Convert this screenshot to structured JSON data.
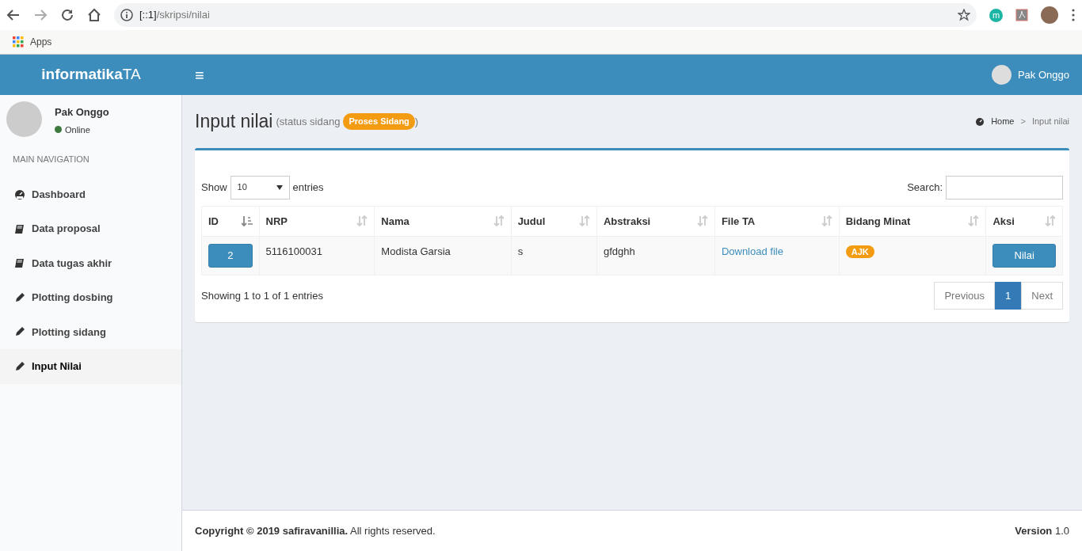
{
  "browser": {
    "url_host": "[::1]",
    "url_path": "/skripsi/nilai",
    "bookmarks": [
      {
        "label": "Apps"
      }
    ],
    "extension_label": "m"
  },
  "header": {
    "logo_bold": "informatika",
    "logo_light": "TA",
    "menu_glyph": "≡",
    "user_name": "Pak Onggo"
  },
  "sidebar": {
    "user_name": "Pak Onggo",
    "status": "Online",
    "section": "MAIN NAVIGATION",
    "items": [
      {
        "label": "Dashboard",
        "kind": "dashboard",
        "selected": false
      },
      {
        "label": "Data proposal",
        "kind": "book",
        "selected": false
      },
      {
        "label": "Data tugas akhir",
        "kind": "book",
        "selected": false
      },
      {
        "label": "Plotting dosbing",
        "kind": "pencil",
        "selected": false
      },
      {
        "label": "Plotting sidang",
        "kind": "pencil",
        "selected": false
      },
      {
        "label": "Input Nilai",
        "kind": "pencil",
        "selected": true
      }
    ]
  },
  "page": {
    "title": "Input nilai",
    "subtitle_before": "(status sidang",
    "status_badge": "Proses Sidang",
    "subtitle_after": ")",
    "breadcrumb_separator": ">",
    "breadcrumb": [
      {
        "label": "Home"
      },
      {
        "label": "Input nilai"
      }
    ]
  },
  "table": {
    "show_label": "Show",
    "page_size": "10",
    "entries_label": "entries",
    "search_label": "Search:",
    "columns": [
      {
        "label": "ID",
        "sorted": true
      },
      {
        "label": "NRP",
        "sorted": false
      },
      {
        "label": "Nama",
        "sorted": false
      },
      {
        "label": "Judul",
        "sorted": false
      },
      {
        "label": "Abstraksi",
        "sorted": false
      },
      {
        "label": "File TA",
        "sorted": false
      },
      {
        "label": "Bidang Minat",
        "sorted": false
      },
      {
        "label": "Aksi",
        "sorted": false
      }
    ],
    "rows": [
      {
        "id": "2",
        "nrp": "5116100031",
        "nama": "Modista Garsia",
        "judul": "s",
        "abstraksi": "gfdghh",
        "file": "Download file",
        "bidang": "AJK",
        "aksi": "Nilai"
      }
    ],
    "info": "Showing 1 to 1 of 1 entries",
    "pagination": [
      {
        "label": "Previous",
        "selected": false
      },
      {
        "label": "1",
        "selected": true
      },
      {
        "label": "Next",
        "selected": false
      }
    ]
  },
  "footer": {
    "copyright": "**Copyright © 2019 safiravanillia.** All rights reserved.",
    "version_label": "Version",
    "version": "1.0"
  }
}
